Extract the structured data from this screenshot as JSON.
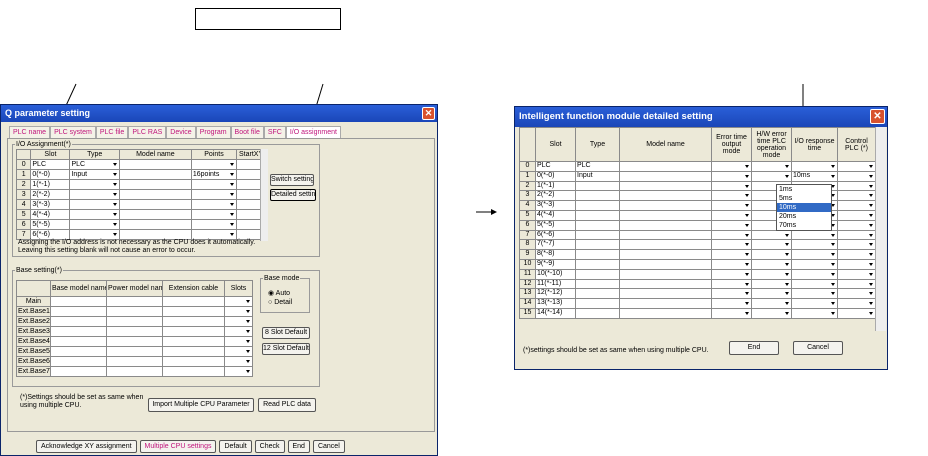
{
  "q_window": {
    "title": "Q parameter setting",
    "close_glyph": "✕",
    "tabs": [
      "PLC name",
      "PLC system",
      "PLC file",
      "PLC RAS",
      "Device",
      "Program",
      "Boot file",
      "SFC",
      "I/O assignment"
    ],
    "io_group_title": "I/O Assignment(*)",
    "io_headers": [
      "Slot",
      "Type",
      "Model name",
      "Points",
      "StartXY"
    ],
    "io_rows": [
      {
        "n": "0",
        "slot": "PLC",
        "type": "PLC",
        "model": "",
        "points": "",
        "start": ""
      },
      {
        "n": "1",
        "slot": "0(*-0)",
        "type": "Input",
        "model": "",
        "points": "16points",
        "start": ""
      },
      {
        "n": "2",
        "slot": "1(*-1)",
        "type": "",
        "model": "",
        "points": "",
        "start": ""
      },
      {
        "n": "3",
        "slot": "2(*-2)",
        "type": "",
        "model": "",
        "points": "",
        "start": ""
      },
      {
        "n": "4",
        "slot": "3(*-3)",
        "type": "",
        "model": "",
        "points": "",
        "start": ""
      },
      {
        "n": "5",
        "slot": "4(*-4)",
        "type": "",
        "model": "",
        "points": "",
        "start": ""
      },
      {
        "n": "6",
        "slot": "5(*-5)",
        "type": "",
        "model": "",
        "points": "",
        "start": ""
      },
      {
        "n": "7",
        "slot": "6(*-6)",
        "type": "",
        "model": "",
        "points": "",
        "start": ""
      }
    ],
    "switch_setting": "Switch setting",
    "detailed_setting": "Detailed setting",
    "io_note": "Assigning the I/O address is not necessary as the CPU does it automatically.\nLeaving this setting blank will not cause an error to occur.",
    "base_group_title": "Base setting(*)",
    "base_headers": [
      "",
      "Base model name",
      "Power model name",
      "Extension cable",
      "Slots"
    ],
    "base_rows": [
      "Main",
      "Ext.Base1",
      "Ext.Base2",
      "Ext.Base3",
      "Ext.Base4",
      "Ext.Base5",
      "Ext.Base6",
      "Ext.Base7"
    ],
    "base_mode_title": "Base mode",
    "base_mode_auto": "Auto",
    "base_mode_detail": "Detail",
    "slot8_default": "8 Slot Default",
    "slot12_default": "12 Slot Default",
    "multi_cpu_note": "(*)Settings should be set as same when\n   using multiple CPU.",
    "import_multi_cpu": "Import Multiple CPU Parameter",
    "read_plc_data": "Read PLC data",
    "bottom_buttons": [
      "Acknowledge XY assignment",
      "Multiple CPU settings",
      "Default",
      "Check",
      "End",
      "Cancel"
    ]
  },
  "if_window": {
    "title": "Intelligent function module detailed setting",
    "close_glyph": "✕",
    "headers": [
      "",
      "Slot",
      "Type",
      "Model name",
      "Error time output mode",
      "H/W error time PLC operation mode",
      "I/O response time",
      "Control PLC (*)"
    ],
    "rows": [
      {
        "n": "0",
        "slot": "PLC",
        "type": "PLC",
        "resp": ""
      },
      {
        "n": "1",
        "slot": "0(*-0)",
        "type": "Input",
        "resp": "10ms"
      },
      {
        "n": "2",
        "slot": "1(*-1)",
        "type": "",
        "resp": ""
      },
      {
        "n": "3",
        "slot": "2(*-2)",
        "type": "",
        "resp": ""
      },
      {
        "n": "4",
        "slot": "3(*-3)",
        "type": "",
        "resp": ""
      },
      {
        "n": "5",
        "slot": "4(*-4)",
        "type": "",
        "resp": ""
      },
      {
        "n": "6",
        "slot": "5(*-5)",
        "type": "",
        "resp": ""
      },
      {
        "n": "7",
        "slot": "6(*-6)",
        "type": "",
        "resp": ""
      },
      {
        "n": "8",
        "slot": "7(*-7)",
        "type": "",
        "resp": ""
      },
      {
        "n": "9",
        "slot": "8(*-8)",
        "type": "",
        "resp": ""
      },
      {
        "n": "10",
        "slot": "9(*-9)",
        "type": "",
        "resp": ""
      },
      {
        "n": "11",
        "slot": "10(*-10)",
        "type": "",
        "resp": ""
      },
      {
        "n": "12",
        "slot": "11(*-11)",
        "type": "",
        "resp": ""
      },
      {
        "n": "13",
        "slot": "12(*-12)",
        "type": "",
        "resp": ""
      },
      {
        "n": "14",
        "slot": "13(*-13)",
        "type": "",
        "resp": ""
      },
      {
        "n": "15",
        "slot": "14(*-14)",
        "type": "",
        "resp": ""
      }
    ],
    "dropdown_options": [
      "1ms",
      "5ms",
      "10ms",
      "20ms",
      "70ms"
    ],
    "dropdown_selected_index": 2,
    "note": "(*)settings should be set as same when using multiple CPU.",
    "end": "End",
    "cancel": "Cancel"
  }
}
